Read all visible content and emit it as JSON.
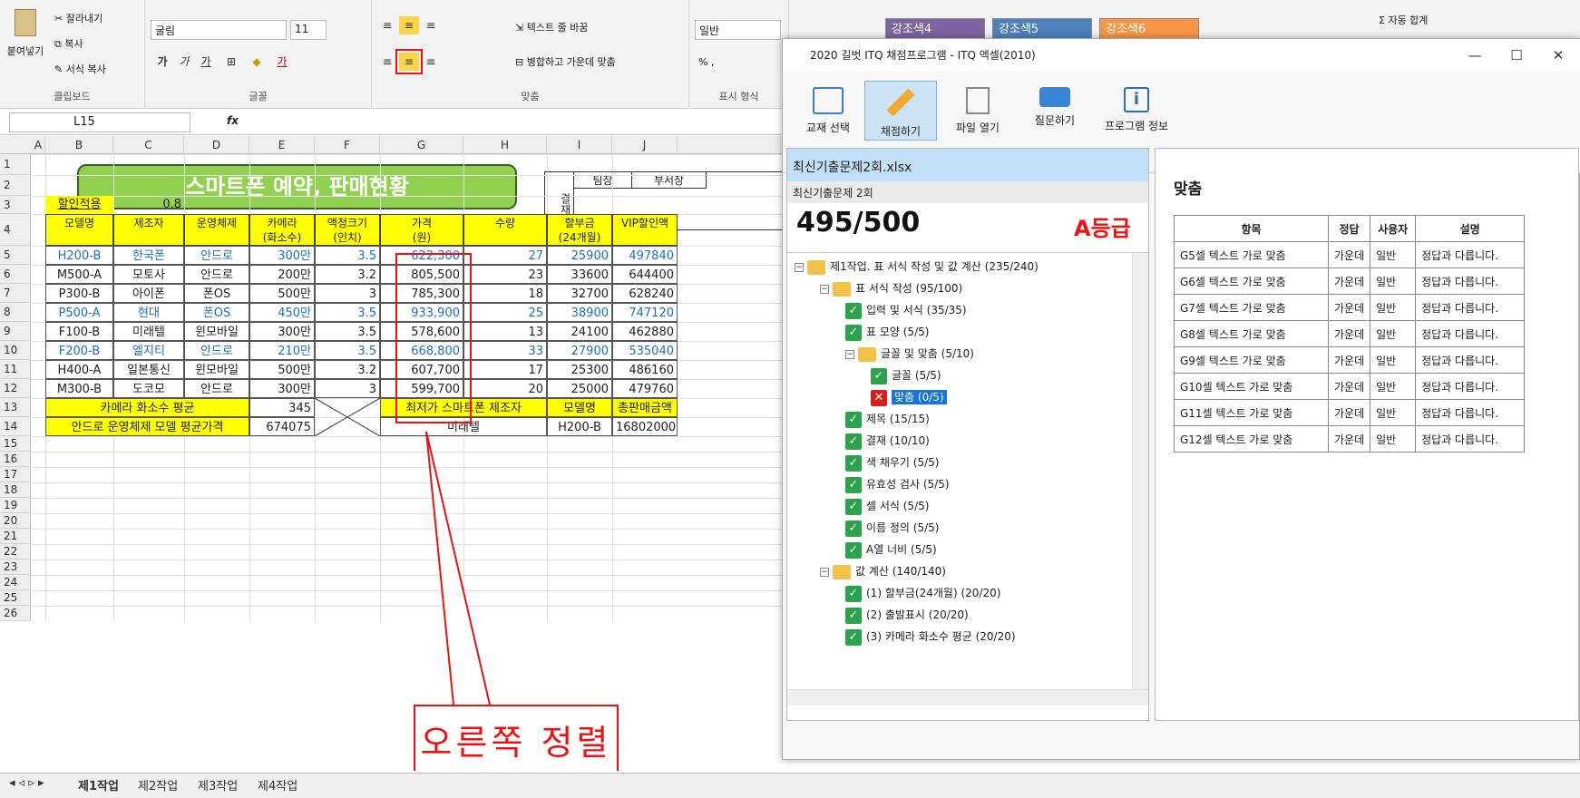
{
  "ribbon": {
    "paste": "붙여넣기",
    "cut": "잘라내기",
    "copy": "복사",
    "format_painter": "서식 복사",
    "clipboard_label": "클립보드",
    "font_name": "굴림",
    "font_size": "11",
    "font_label": "글꼴",
    "wrap_text": "텍스트 줄 바꿈",
    "merge_center": "병합하고 가운데 맞춤",
    "align_label": "맞춤",
    "number_format": "일반",
    "number_label": "표시 형식",
    "styles": [
      {
        "label": "강조색4",
        "color": "#8064a2"
      },
      {
        "label": "강조색5",
        "color": "#4f81bd"
      },
      {
        "label": "강조색6",
        "color": "#f79646"
      }
    ],
    "autosum": "자동 합계"
  },
  "formula_bar": {
    "cell_ref": "L15",
    "fx": "fx"
  },
  "sheet": {
    "columns": [
      "A",
      "B",
      "C",
      "D",
      "E",
      "F",
      "G",
      "H",
      "I",
      "J"
    ],
    "rows": [
      "1",
      "2",
      "3",
      "4",
      "5",
      "6",
      "7",
      "8",
      "9",
      "10",
      "11",
      "12",
      "13",
      "14",
      "15",
      "16",
      "17",
      "18",
      "19",
      "20",
      "21",
      "22",
      "23",
      "24",
      "25",
      "26"
    ],
    "title": "스마트폰 예약, 판매현황",
    "approval": {
      "label": "결재",
      "col1": "팀장",
      "col2": "부서장"
    },
    "discount_label": "할인적용",
    "discount_value": "0.8",
    "headers": [
      "모델명",
      "제조자",
      "운영체제",
      "카메라\n(화소수)",
      "액정크기\n(인치)",
      "가격\n(원)",
      "수량",
      "할부금\n(24개월)",
      "VIP할인액"
    ],
    "data": [
      [
        "H200-B",
        "한국폰",
        "안드로",
        "300만",
        "3.5",
        "622,300",
        "27",
        "25900",
        "497840"
      ],
      [
        "M500-A",
        "모토사",
        "안드로",
        "200만",
        "3.2",
        "805,500",
        "23",
        "33600",
        "644400"
      ],
      [
        "P300-B",
        "아이폰",
        "폰OS",
        "500만",
        "3",
        "785,300",
        "18",
        "32700",
        "628240"
      ],
      [
        "P500-A",
        "현대",
        "폰OS",
        "450만",
        "3.5",
        "933,900",
        "25",
        "38900",
        "747120"
      ],
      [
        "F100-B",
        "미래텔",
        "윈모바일",
        "300만",
        "3.5",
        "578,600",
        "13",
        "24100",
        "462880"
      ],
      [
        "F200-B",
        "엘지티",
        "안드로",
        "210만",
        "3.5",
        "668,800",
        "33",
        "27900",
        "535040"
      ],
      [
        "H400-A",
        "일본통신",
        "윈모바일",
        "500만",
        "3.2",
        "607,700",
        "17",
        "25300",
        "486160"
      ],
      [
        "M300-B",
        "도코모",
        "안드로",
        "300만",
        "3",
        "599,700",
        "20",
        "25000",
        "479760"
      ]
    ],
    "blue_rows": [
      0,
      3,
      5
    ],
    "row13": {
      "label": "카메라 화소수 평균",
      "value": "345",
      "label2": "최저가 스마트폰 제조자",
      "model_label": "모델명",
      "total_label": "총판매금액"
    },
    "row14": {
      "label": "안드로 운영체제 모델 평균가격",
      "value": "674075",
      "maker": "미래텔",
      "model": "H200-B",
      "total": "16802000"
    },
    "tabs": [
      "제1작업",
      "제2작업",
      "제3작업",
      "제4작업"
    ],
    "callout": "오른쪽 정렬"
  },
  "grader": {
    "title": "2020 길벗 ITQ 채점프로그램 - ITQ 엑셀(2010)",
    "toolbar": [
      "교재 선택",
      "채점하기",
      "파일 열기",
      "질문하기",
      "프로그램 정보"
    ],
    "file": "최신기출문제2회.xlsx",
    "subtitle": "최신기출문제 2회",
    "score": "495/500",
    "grade": "A등급",
    "tree": [
      {
        "t": "제1작업. 표 서식 작성 및 값 계산 (235/240)",
        "lvl": 0,
        "k": "folder"
      },
      {
        "t": "표 서식 작성 (95/100)",
        "lvl": 1,
        "k": "folder"
      },
      {
        "t": "입력 및 서식 (35/35)",
        "lvl": 2,
        "k": "ok"
      },
      {
        "t": "표 모양 (5/5)",
        "lvl": 2,
        "k": "ok"
      },
      {
        "t": "글꼴 및 맞춤 (5/10)",
        "lvl": 2,
        "k": "folder"
      },
      {
        "t": "글꼴 (5/5)",
        "lvl": 3,
        "k": "ok"
      },
      {
        "t": "맞춤 (0/5)",
        "lvl": 3,
        "k": "bad"
      },
      {
        "t": "제목 (15/15)",
        "lvl": 2,
        "k": "ok"
      },
      {
        "t": "결재 (10/10)",
        "lvl": 2,
        "k": "ok"
      },
      {
        "t": "색 채우기 (5/5)",
        "lvl": 2,
        "k": "ok"
      },
      {
        "t": "유효성 검사 (5/5)",
        "lvl": 2,
        "k": "ok"
      },
      {
        "t": "셀 서식 (5/5)",
        "lvl": 2,
        "k": "ok"
      },
      {
        "t": "이름 정의 (5/5)",
        "lvl": 2,
        "k": "ok"
      },
      {
        "t": "A열 너비 (5/5)",
        "lvl": 2,
        "k": "ok"
      },
      {
        "t": "값 계산 (140/140)",
        "lvl": 1,
        "k": "folder"
      },
      {
        "t": "(1) 할부금(24개월) (20/20)",
        "lvl": 2,
        "k": "ok"
      },
      {
        "t": "(2) 출발표시 (20/20)",
        "lvl": 2,
        "k": "ok"
      },
      {
        "t": "(3) 카메라 화소수 평균 (20/20)",
        "lvl": 2,
        "k": "ok"
      }
    ],
    "detail_title": "맞춤",
    "detail_headers": [
      "항목",
      "정답",
      "사용자",
      "설명"
    ],
    "detail_rows": [
      [
        "G5셀 텍스트 가로 맞춤",
        "가운데",
        "일반",
        "정답과 다릅니다."
      ],
      [
        "G6셀 텍스트 가로 맞춤",
        "가운데",
        "일반",
        "정답과 다릅니다."
      ],
      [
        "G7셀 텍스트 가로 맞춤",
        "가운데",
        "일반",
        "정답과 다릅니다."
      ],
      [
        "G8셀 텍스트 가로 맞춤",
        "가운데",
        "일반",
        "정답과 다릅니다."
      ],
      [
        "G9셀 텍스트 가로 맞춤",
        "가운데",
        "일반",
        "정답과 다릅니다."
      ],
      [
        "G10셀 텍스트 가로 맞춤",
        "가운데",
        "일반",
        "정답과 다릅니다."
      ],
      [
        "G11셀 텍스트 가로 맞춤",
        "가운데",
        "일반",
        "정답과 다릅니다."
      ],
      [
        "G12셀 텍스트 가로 맞춤",
        "가운데",
        "일반",
        "정답과 다릅니다."
      ]
    ]
  }
}
